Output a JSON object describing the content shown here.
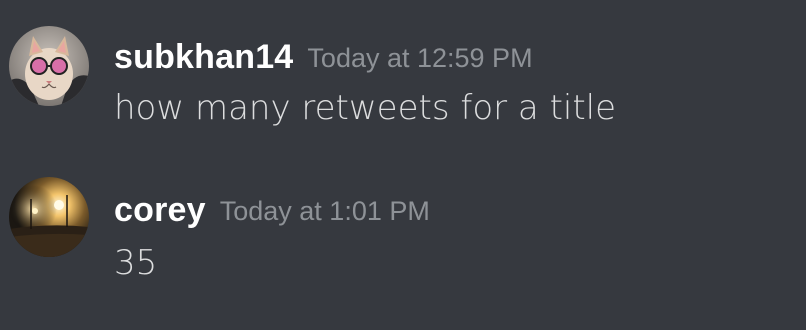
{
  "theme": {
    "background": "#36393f",
    "username_color": "#ffffff",
    "timestamp_color": "#8e9297",
    "text_color": "#dcddde"
  },
  "messages": [
    {
      "username": "subkhan14",
      "timestamp": "Today at 12:59 PM",
      "text": "how many retweets for a title",
      "avatar_icon": "cat-with-sunglasses-avatar"
    },
    {
      "username": "corey",
      "timestamp": "Today at 1:01 PM",
      "text": "35",
      "avatar_icon": "night-street-lights-avatar"
    }
  ]
}
